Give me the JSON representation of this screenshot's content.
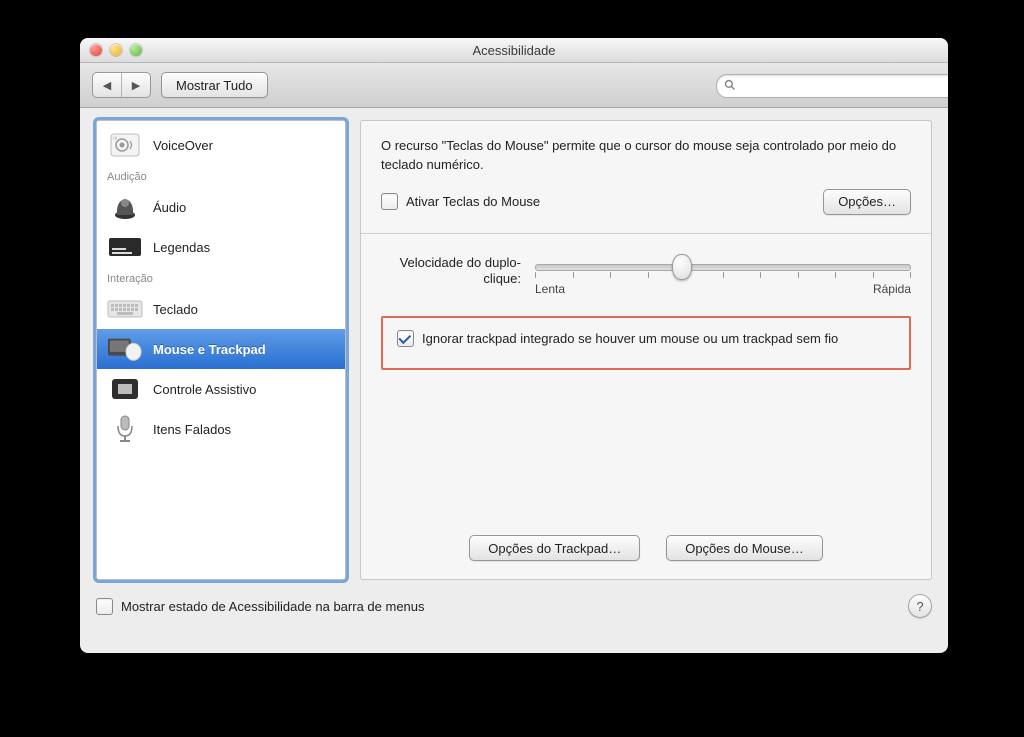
{
  "window": {
    "title": "Acessibilidade"
  },
  "toolbar": {
    "back_icon": "◀",
    "forward_icon": "▶",
    "show_all": "Mostrar Tudo",
    "search_placeholder": ""
  },
  "sidebar": {
    "items": [
      {
        "label": "VoiceOver"
      }
    ],
    "cat_audicao": "Audição",
    "audicao": [
      {
        "label": "Áudio"
      },
      {
        "label": "Legendas"
      }
    ],
    "cat_interacao": "Interação",
    "interacao": [
      {
        "label": "Teclado"
      },
      {
        "label": "Mouse e Trackpad",
        "selected": true
      },
      {
        "label": "Controle Assistivo"
      },
      {
        "label": "Itens Falados"
      }
    ]
  },
  "main": {
    "desc": "O recurso \"Teclas do Mouse\" permite que o cursor do mouse seja controlado por meio do teclado numérico.",
    "mouse_keys_label": "Ativar Teclas do Mouse",
    "options_btn": "Opções…",
    "dblclick_label": "Velocidade do duplo-clique:",
    "slow": "Lenta",
    "fast": "Rápida",
    "slider_pos_pct": 39,
    "ignore_trackpad_label": "Ignorar trackpad integrado se houver um mouse ou um trackpad sem fio",
    "trackpad_options": "Opções do Trackpad…",
    "mouse_options": "Opções do Mouse…"
  },
  "global": {
    "show_status_label": "Mostrar estado de Acessibilidade na barra de menus",
    "help": "?"
  }
}
